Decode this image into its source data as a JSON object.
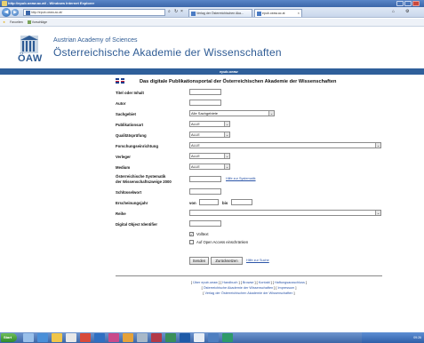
{
  "window": {
    "title": "http://epub.oeaw.ac.at/ - Windows Internet Explorer"
  },
  "browser": {
    "url": "http://epub.oeaw.ac.at/",
    "tabs": [
      {
        "label": "Verlag der Österreichischen Aka..."
      },
      {
        "label": "epub.oeaw.ac.at"
      }
    ],
    "favorites": {
      "label": "Favoriten",
      "suggested": "Vorschläge"
    }
  },
  "header": {
    "logo_text": "ÖAW",
    "title_en": "Austrian Academy of Sciences",
    "title_de": "Österreichische Akademie der Wissenschaften",
    "strip_label": "epub.oeaw"
  },
  "main": {
    "heading": "Das digitale Publikationsportal der Österreichischen Akademie der Wissenschaften"
  },
  "form": {
    "fields": {
      "titel": {
        "label": "Titel oder Inhalt",
        "value": ""
      },
      "autor": {
        "label": "Autor",
        "value": ""
      },
      "sachgebiet": {
        "label": "Sachgebiet",
        "value": "Alle Sachgebiete"
      },
      "publikationsart": {
        "label": "Publikationsart",
        "value": "ALLE"
      },
      "qualitaet": {
        "label": "Qualitätsprüfung",
        "value": "ALLE"
      },
      "forschung": {
        "label": "Forschungseinrichtung",
        "value": "ALLE"
      },
      "verleger": {
        "label": "Verleger",
        "value": "ALLE"
      },
      "medium": {
        "label": "Medium",
        "value": "ALLE"
      },
      "systematik": {
        "label_line1": "Österreichische Systematik",
        "label_line2": "der Wissenschaftszweige 2000",
        "value": "",
        "hint": "Hilfe zur Systematik"
      },
      "schluessel": {
        "label": "Schlüsselwort",
        "value": ""
      },
      "jahr": {
        "label": "Erscheinungsjahr",
        "von": "von",
        "bis": "bis",
        "from_value": "",
        "to_value": ""
      },
      "reihe": {
        "label": "Reihe",
        "value": ""
      },
      "doi": {
        "label": "Digital Object Identifier",
        "value": ""
      }
    },
    "options": {
      "volltext": "Volltext",
      "open_access": "Auf Open Access einschränken"
    },
    "buttons": {
      "senden": "Senden",
      "zuruecksetzen": "Zurücksetzen",
      "hilfe": "Hilfe zur Suche"
    }
  },
  "footer": {
    "line1": [
      "Über epub.oeaw",
      "Handbuch",
      "Browse",
      "Kontakt",
      "Haftungsausschluss"
    ],
    "line2": [
      "Österreichische Akademie der Wissenschaften",
      "Impressum"
    ],
    "line3": [
      "Verlag der Österreichischen Akademie der Wissenschaften"
    ]
  },
  "taskbar": {
    "start_label": "Start",
    "clock": "09:26"
  }
}
